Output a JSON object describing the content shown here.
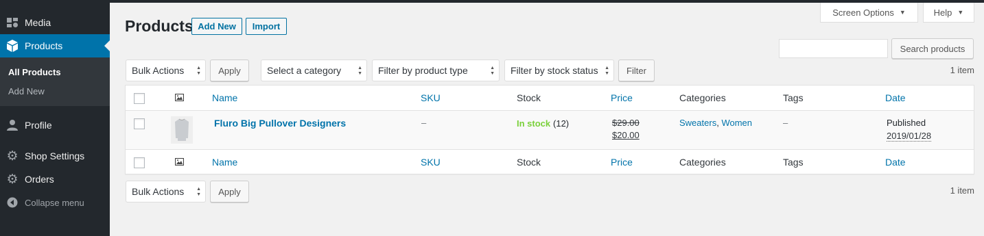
{
  "sidebar": {
    "media": "Media",
    "products": "Products",
    "all_products": "All Products",
    "add_new": "Add New",
    "profile": "Profile",
    "shop_settings": "Shop Settings",
    "orders": "Orders",
    "collapse": "Collapse menu"
  },
  "screen_meta": {
    "screen_options": "Screen Options",
    "help": "Help"
  },
  "header": {
    "title": "Products",
    "add_new": "Add New",
    "import": "Import"
  },
  "search": {
    "button": "Search products",
    "value": ""
  },
  "top_controls": {
    "bulk_actions": "Bulk Actions",
    "apply": "Apply",
    "category": "Select a category",
    "product_type": "Filter by product type",
    "stock_status": "Filter by stock status",
    "filter": "Filter",
    "count": "1 item"
  },
  "table": {
    "columns": {
      "name": "Name",
      "sku": "SKU",
      "stock": "Stock",
      "price": "Price",
      "categories": "Categories",
      "tags": "Tags",
      "date": "Date"
    },
    "rows": [
      {
        "name": "Fluro Big Pullover Designers",
        "sku": "–",
        "stock_status": "In stock",
        "stock_qty": "(12)",
        "price_regular": "$29.00",
        "price_sale": "$20.00",
        "category_1": "Sweaters",
        "category_sep": ", ",
        "category_2": "Women",
        "tags": "–",
        "date_status": "Published",
        "date": "2019/01/28"
      }
    ]
  },
  "bottom_controls": {
    "bulk_actions": "Bulk Actions",
    "apply": "Apply",
    "count": "1 item"
  },
  "colors": {
    "accent": "#0073aa",
    "sidebar": "#23282d",
    "in_stock": "#7ad03a"
  }
}
